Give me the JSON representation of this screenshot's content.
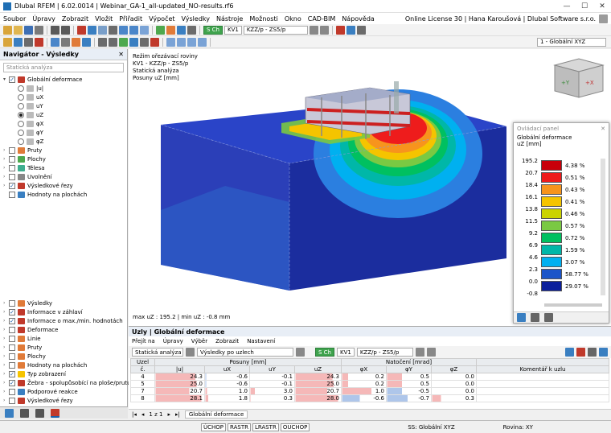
{
  "window": {
    "title": "Dlubal RFEM | 6.02.0014 | Webinar_GA-1_all-updated_NO-results.rf6"
  },
  "menu": {
    "items": [
      "Soubor",
      "Úpravy",
      "Zobrazit",
      "Vložit",
      "Přiřadit",
      "Výpočet",
      "Výsledky",
      "Nástroje",
      "Možnosti",
      "Okno",
      "CAD-BIM",
      "Nápověda"
    ],
    "license": "Online License 30 | Hana Karoušová | Dlubal Software s.r.o."
  },
  "toolbar": {
    "load_case_tag": "S Ch",
    "load_case": "KV1",
    "combo": "KZZ/p - ZS5/p",
    "coord_system": "1 - Globální XYZ"
  },
  "navigator": {
    "title": "Navigátor - Výsledky",
    "dropdown": "Statická analýza",
    "tree": [
      {
        "label": "Globální deformace",
        "type": "check",
        "checked": true
      },
      {
        "label": "|u|",
        "type": "radio",
        "on": false
      },
      {
        "label": "uX",
        "type": "radio",
        "on": false
      },
      {
        "label": "uY",
        "type": "radio",
        "on": false
      },
      {
        "label": "uZ",
        "type": "radio",
        "on": true
      },
      {
        "label": "φX",
        "type": "radio",
        "on": false
      },
      {
        "label": "φY",
        "type": "radio",
        "on": false
      },
      {
        "label": "φZ",
        "type": "radio",
        "on": false
      },
      {
        "label": "Pruty",
        "type": "check",
        "checked": false
      },
      {
        "label": "Plochy",
        "type": "check",
        "checked": false
      },
      {
        "label": "Tělesa",
        "type": "check",
        "checked": false
      },
      {
        "label": "Uvolnění",
        "type": "check",
        "checked": false
      },
      {
        "label": "Výsledkové řezy",
        "type": "check",
        "checked": true
      },
      {
        "label": "Hodnoty na plochách",
        "type": "check",
        "checked": false
      }
    ],
    "tree2": [
      {
        "label": "Výsledky",
        "checked": false
      },
      {
        "label": "Informace v záhlaví",
        "checked": true
      },
      {
        "label": "Informace o max./min. hodnotách",
        "checked": true
      },
      {
        "label": "Deformace",
        "checked": false
      },
      {
        "label": "Linie",
        "checked": false
      },
      {
        "label": "Pruty",
        "checked": false
      },
      {
        "label": "Plochy",
        "checked": false
      },
      {
        "label": "Hodnoty na plochách",
        "checked": false
      },
      {
        "label": "Typ zobrazení",
        "checked": true
      },
      {
        "label": "Žebra - spolupůsobící na ploše/prutu",
        "checked": true
      },
      {
        "label": "Podporové reakce",
        "checked": false
      },
      {
        "label": "Výsledkové řezy",
        "checked": false
      }
    ]
  },
  "view": {
    "info": [
      "Režim ořezávací roviny",
      "KV1 - KZZ/p - ZS5/p",
      "Statická analýza",
      "Posuny uZ [mm]"
    ],
    "maxmin": "max uZ : 195.2 | min uZ : -0.8 mm"
  },
  "control_panel": {
    "title": "Ovládací panel",
    "subtitle": "Globální deformace",
    "unit": "uZ [mm]",
    "legend": [
      {
        "value": "195.2",
        "color": "#c8000a",
        "pct": "4.38 %"
      },
      {
        "value": "20.7",
        "color": "#ee1c1c",
        "pct": "0.51 %"
      },
      {
        "value": "18.4",
        "color": "#f7941d",
        "pct": "0.43 %"
      },
      {
        "value": "16.1",
        "color": "#f5c400",
        "pct": "0.41 %"
      },
      {
        "value": "13.8",
        "color": "#cbd300",
        "pct": "0.46 %"
      },
      {
        "value": "11.5",
        "color": "#7ac943",
        "pct": "0.57 %"
      },
      {
        "value": "9.2",
        "color": "#00c060",
        "pct": "0.72 %"
      },
      {
        "value": "6.9",
        "color": "#00b7a8",
        "pct": "1.59 %"
      },
      {
        "value": "4.6",
        "color": "#00b0f0",
        "pct": "3.07 %"
      },
      {
        "value": "2.3",
        "color": "#1b55c9",
        "pct": "58.77 %"
      },
      {
        "value": "0.0",
        "color": "#0b1f9c",
        "pct": "29.07 %"
      }
    ],
    "legend_min": "-0.8"
  },
  "table_panel": {
    "title": "Uzly | Globální deformace",
    "menu": [
      "Přejít na",
      "Úpravy",
      "Výběr",
      "Zobrazit",
      "Nastavení"
    ],
    "analysis": "Statická analýza",
    "results_by": "Výsledky po uzlech",
    "lc_tag": "S Ch",
    "lc": "KV1",
    "combo": "KZZ/p - ZS5/p",
    "group_headers": {
      "node": "Uzel",
      "posuny": "Posuny [mm]",
      "natoceni": "Natočení [mrad]"
    },
    "columns": [
      "č.",
      "|u|",
      "uX",
      "uY",
      "uZ",
      "φX",
      "φY",
      "φZ",
      "Komentář k uzlu"
    ],
    "rows": [
      {
        "n": "4",
        "u": "24.3",
        "ux": "-0.6",
        "uy": "-0.1",
        "uz": "24.3",
        "fx": "0.2",
        "fy": "0.5",
        "fz": "0.0"
      },
      {
        "n": "5",
        "u": "25.0",
        "ux": "-0.6",
        "uy": "-0.1",
        "uz": "25.0",
        "fx": "0.2",
        "fy": "0.5",
        "fz": "0.0"
      },
      {
        "n": "7",
        "u": "20.7",
        "ux": "1.0",
        "uy": "3.0",
        "uz": "20.7",
        "fx": "1.0",
        "fy": "-0.5",
        "fz": "0.0"
      },
      {
        "n": "8",
        "u": "28.1",
        "ux": "1.8",
        "uy": "0.3",
        "uz": "28.0",
        "fx": "-0.6",
        "fy": "-0.7",
        "fz": "0.3"
      }
    ],
    "pager": "1 z 1",
    "tab": "Globální deformace"
  },
  "status": {
    "buttons": [
      "ÚCHOP",
      "RASTR",
      "LRASTR",
      "OUCHOP"
    ],
    "cs": "SS: Globální XYZ",
    "plane": "Rovina: XY"
  }
}
